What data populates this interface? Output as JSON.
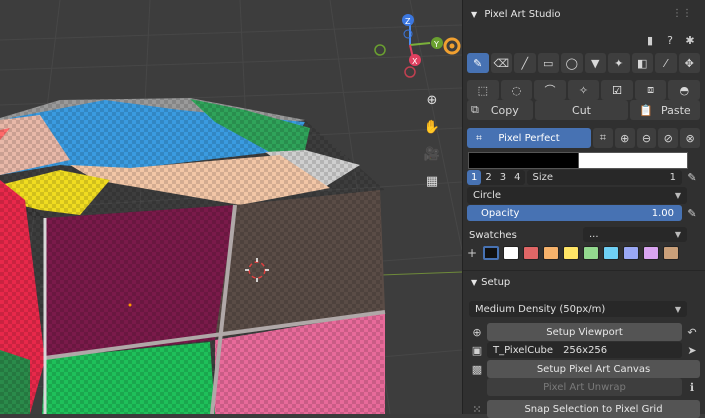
{
  "panel": {
    "title": "Pixel Art Studio",
    "clipboard": {
      "copy": "Copy",
      "cut": "Cut",
      "paste": "Paste"
    },
    "pixel_perfect": "Pixel Perfect",
    "brush_sizes": [
      "1",
      "2",
      "3",
      "4"
    ],
    "size_label": "Size",
    "size_value": "1",
    "shape": "Circle",
    "opacity_label": "Opacity",
    "opacity_value": "1.00",
    "swatches_label": "Swatches",
    "swatches_dropdown": "...",
    "swatch_colors": [
      "#111111",
      "#ffffff",
      "#e06666",
      "#f6b26b",
      "#ffe566",
      "#93d98f",
      "#6fd0f5",
      "#9aa8f5",
      "#d9a4f0",
      "#caa07a"
    ],
    "setup_header": "Setup",
    "density": "Medium Density (50px/m)",
    "setup_viewport": "Setup Viewport",
    "texture_name": "T_PixelCube",
    "texture_size": "256x256",
    "setup_canvas": "Setup Pixel Art Canvas",
    "unwrap": "Pixel Art Unwrap",
    "snap": "Snap Selection to Pixel Grid"
  },
  "gizmo": {
    "z": "Z",
    "x": "X",
    "y": "Y"
  },
  "colors": {
    "accent": "#4772b3",
    "panel_bg": "#303030",
    "viewport_bg": "#3d3d3d"
  }
}
